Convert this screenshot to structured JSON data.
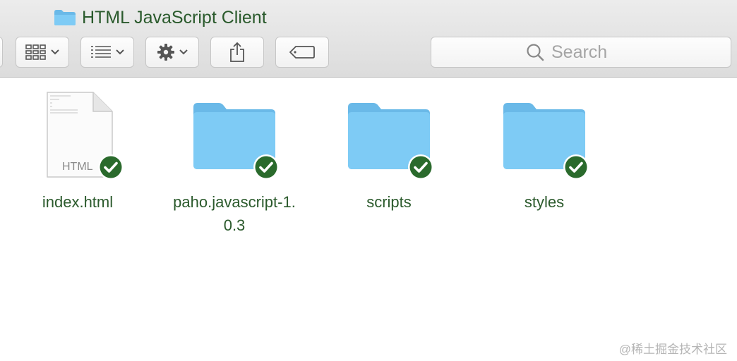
{
  "window": {
    "title": "HTML JavaScript Client"
  },
  "toolbar": {
    "view_button": {
      "icon": "icon-grid-view-icon"
    },
    "arrange_button": {
      "icon": "list-arrange-icon"
    },
    "action_button": {
      "icon": "gear-icon"
    },
    "share_button": {
      "icon": "share-icon"
    },
    "tags_button": {
      "icon": "tag-icon"
    }
  },
  "search": {
    "placeholder": "Search"
  },
  "files": [
    {
      "name": "index.html",
      "kind": "html-file",
      "icon_label": "HTML",
      "synced": true
    },
    {
      "name_line1": "paho.javascript-1.",
      "name_line2": "0.3",
      "kind": "folder",
      "synced": true
    },
    {
      "name": "scripts",
      "kind": "folder",
      "synced": true
    },
    {
      "name": "styles",
      "kind": "folder",
      "synced": true
    }
  ],
  "colors": {
    "folder": "#7ecbf5",
    "folder_tab": "#6ab9e8",
    "badge": "#2a6a2c",
    "label_text": "#2b5a2c"
  },
  "watermark": "@稀土掘金技术社区"
}
